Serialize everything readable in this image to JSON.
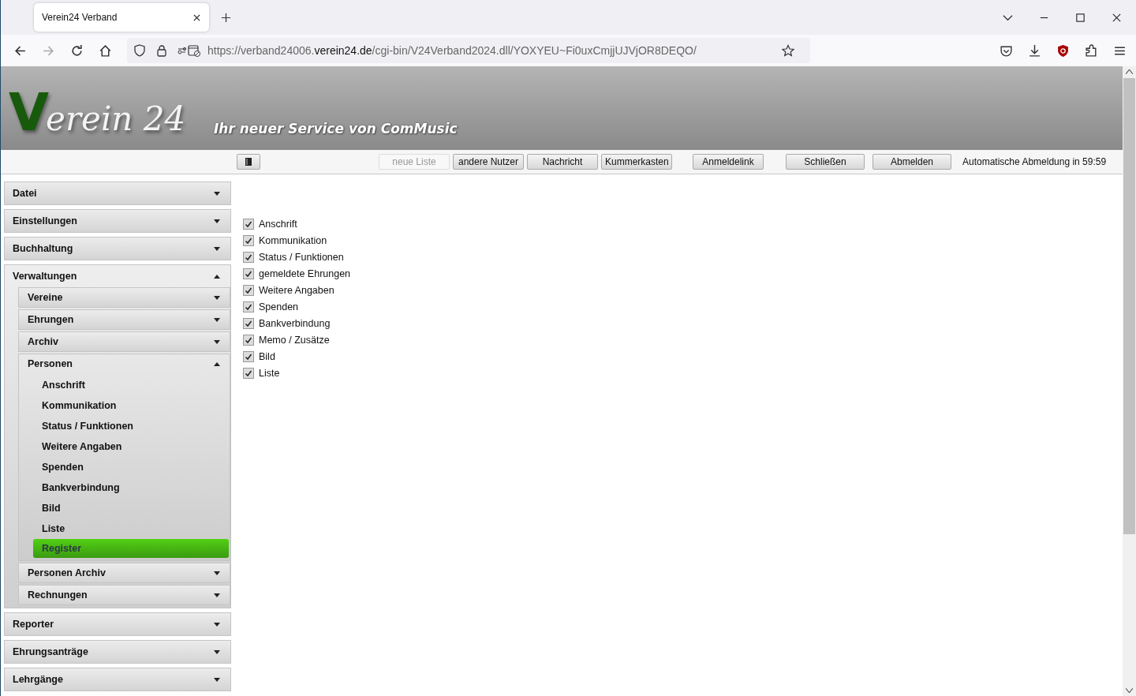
{
  "browser": {
    "tab_title": "Verein24 Verband",
    "url": {
      "host_prefix": "https://verband24006.",
      "domain": "verein24.de",
      "path": "/cgi-bin/V24Verband2024.dll/YOXYEU~Fi0uxCmjjUJVjOR8DEQO/"
    }
  },
  "header": {
    "logo": {
      "initial": "V",
      "rest": "erein 24"
    },
    "tagline": "Ihr neuer Service von ComMusic"
  },
  "toolbar": {
    "buttons": [
      {
        "label": "neue Liste",
        "disabled": true
      },
      {
        "label": "andere Nutzer",
        "disabled": false
      },
      {
        "label": "Nachricht",
        "disabled": false
      },
      {
        "label": "Kummerkasten",
        "disabled": false
      },
      {
        "label": "Anmeldelink",
        "disabled": false
      },
      {
        "label": "Schließen",
        "disabled": false
      },
      {
        "label": "Abmelden",
        "disabled": false
      }
    ],
    "auto_logout": "Automatische Abmeldung in 59:59"
  },
  "sidebar": {
    "items": [
      {
        "kind": "group",
        "label": "Datei",
        "expanded": false
      },
      {
        "kind": "group",
        "label": "Einstellungen",
        "expanded": false
      },
      {
        "kind": "group",
        "label": "Buchhaltung",
        "expanded": false
      },
      {
        "kind": "group",
        "label": "Verwaltungen",
        "expanded": true,
        "children": [
          {
            "kind": "group",
            "label": "Vereine",
            "expanded": false
          },
          {
            "kind": "group",
            "label": "Ehrungen",
            "expanded": false
          },
          {
            "kind": "group",
            "label": "Archiv",
            "expanded": false
          },
          {
            "kind": "group",
            "label": "Personen",
            "expanded": true,
            "children": [
              {
                "kind": "leaf",
                "label": "Anschrift",
                "selected": false
              },
              {
                "kind": "leaf",
                "label": "Kommunikation",
                "selected": false
              },
              {
                "kind": "leaf",
                "label": "Status / Funktionen",
                "selected": false
              },
              {
                "kind": "leaf",
                "label": "Weitere Angaben",
                "selected": false
              },
              {
                "kind": "leaf",
                "label": "Spenden",
                "selected": false
              },
              {
                "kind": "leaf",
                "label": "Bankverbindung",
                "selected": false
              },
              {
                "kind": "leaf",
                "label": "Bild",
                "selected": false
              },
              {
                "kind": "leaf",
                "label": "Liste",
                "selected": false
              },
              {
                "kind": "leaf",
                "label": "Register",
                "selected": true
              }
            ]
          },
          {
            "kind": "group",
            "label": "Personen Archiv",
            "expanded": false
          },
          {
            "kind": "group",
            "label": "Rechnungen",
            "expanded": false
          }
        ]
      },
      {
        "kind": "group",
        "label": "Reporter",
        "expanded": false
      },
      {
        "kind": "group",
        "label": "Ehrungsanträge",
        "expanded": false
      },
      {
        "kind": "group",
        "label": "Lehrgänge",
        "expanded": false
      }
    ]
  },
  "options": [
    {
      "label": "Anschrift",
      "checked": true
    },
    {
      "label": "Kommunikation",
      "checked": true
    },
    {
      "label": "Status / Funktionen",
      "checked": true
    },
    {
      "label": "gemeldete Ehrungen",
      "checked": true
    },
    {
      "label": "Weitere Angaben",
      "checked": true
    },
    {
      "label": "Spenden",
      "checked": true
    },
    {
      "label": "Bankverbindung",
      "checked": true
    },
    {
      "label": "Memo / Zusätze",
      "checked": true
    },
    {
      "label": "Bild",
      "checked": true
    },
    {
      "label": "Liste",
      "checked": true
    }
  ]
}
